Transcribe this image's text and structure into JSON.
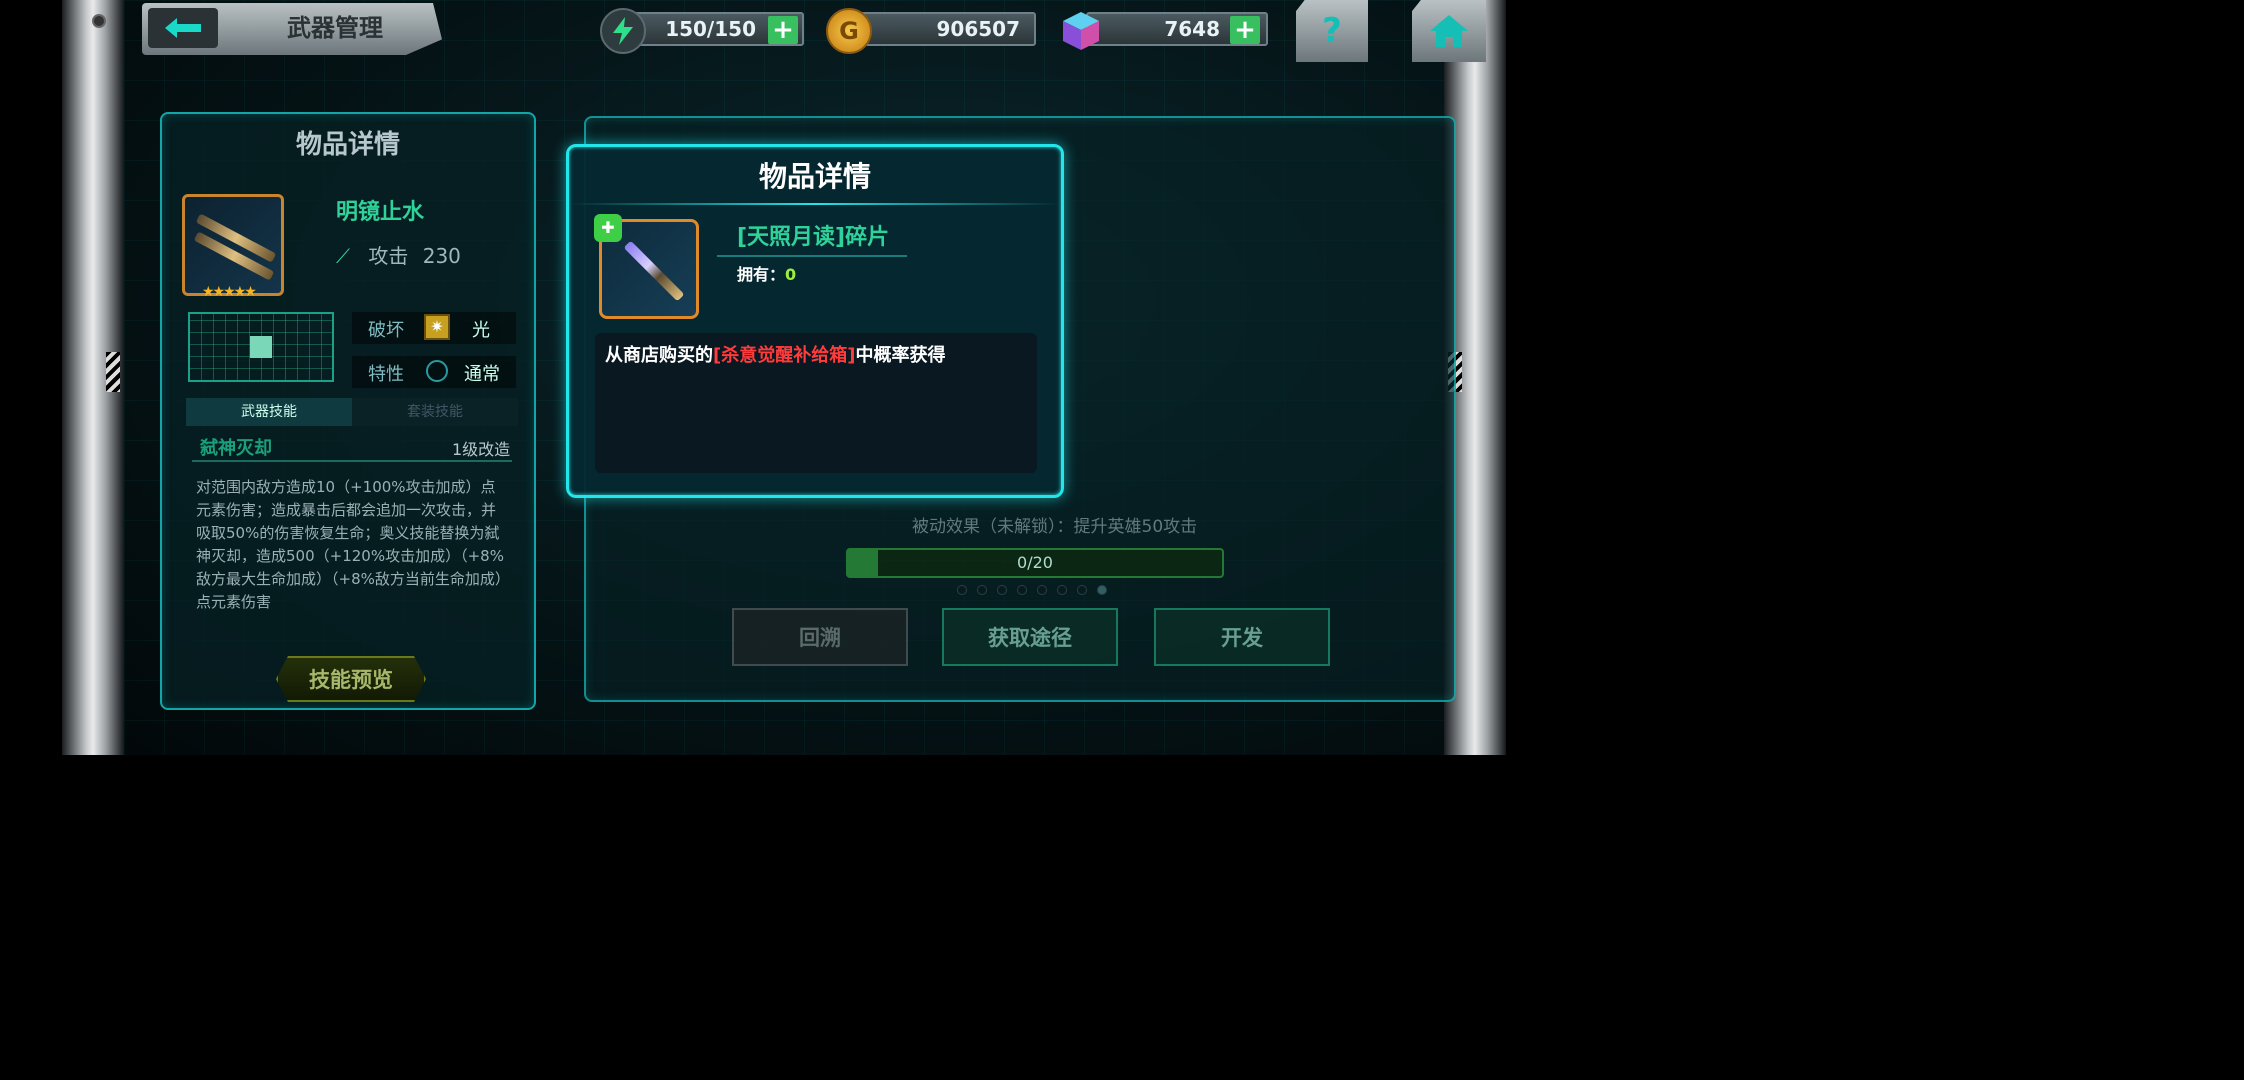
{
  "topbar": {
    "back_icon": "back-arrow-icon",
    "title": "武器管理",
    "stamina": "150/150",
    "stamina_icon": "lightning-icon",
    "gold": "906507",
    "gold_icon": "gold-coin-icon",
    "gold_symbol": "G",
    "gems": "7648",
    "gems_icon": "cube-gem-icon",
    "plus": "+",
    "help_label": "?",
    "home_icon": "home-icon"
  },
  "left_panel": {
    "title": "物品详情",
    "weapon_name": "明镜止水",
    "attack_label": "攻击",
    "attack_value": "230",
    "stars": "★★★★★",
    "break_label": "破坏",
    "break_value": "光",
    "trait_label": "特性",
    "trait_value": "通常",
    "tab_weapon_skill": "武器技能",
    "tab_set_skill": "套装技能",
    "skill_name": "弑神灭却",
    "skill_level": "1级改造",
    "skill_desc": "对范围内敌方造成10（+100%攻击加成）点元素伤害；造成暴击后都会追加一次攻击，并吸取50%的伤害恢复生命；奥义技能替换为弑神灭却，造成500（+120%攻击加成）（+8%敌方最大生命加成）（+8%敌方当前生命加成）点元素伤害",
    "preview_button": "技能预览"
  },
  "right_panel": {
    "passive_text": "被动效果（未解锁）：提升英雄50攻击",
    "progress_text": "0/20",
    "progress_fraction": 0,
    "btn_rollback": "回溯",
    "btn_obtain": "获取途径",
    "btn_develop": "开发"
  },
  "popup": {
    "title": "物品详情",
    "item_name": "[天照月读]碎片",
    "owned_label": "拥有：",
    "owned_value": "0",
    "desc_prefix": "从商店购买的",
    "desc_highlight": "[杀意觉醒补给箱]",
    "desc_suffix": "中概率获得"
  },
  "colors": {
    "accent_cyan": "#23e6ea",
    "name_green": "#2fd39a",
    "highlight_red": "#ff3b3b",
    "owned_green": "#9af03a",
    "gold": "#f2b21e"
  }
}
